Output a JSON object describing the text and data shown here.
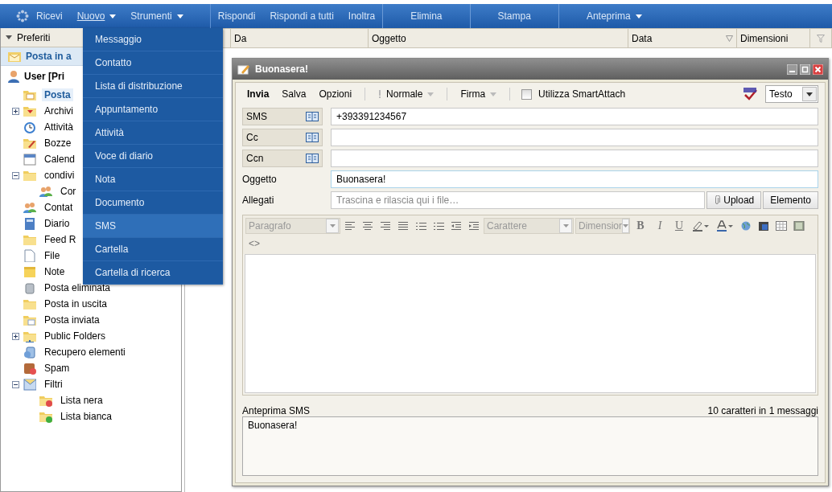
{
  "toolbar": {
    "items": [
      {
        "label": "Ricevi",
        "dropdown": false,
        "selected": false
      },
      {
        "label": "Nuovo",
        "dropdown": true,
        "selected": true
      },
      {
        "label": "Strumenti",
        "dropdown": true,
        "selected": false
      },
      {
        "label": "Rispondi",
        "dropdown": false,
        "selected": false
      },
      {
        "label": "Rispondi a tutti",
        "dropdown": false,
        "selected": false
      },
      {
        "label": "Inoltra",
        "dropdown": false,
        "selected": false
      },
      {
        "label": "Elimina",
        "dropdown": false,
        "selected": false
      },
      {
        "label": "Stampa",
        "dropdown": false,
        "selected": false
      },
      {
        "label": "Anteprima",
        "dropdown": true,
        "selected": false
      }
    ]
  },
  "menu": {
    "items": [
      {
        "label": "Messaggio",
        "selected": false
      },
      {
        "label": "Contatto",
        "selected": false
      },
      {
        "label": "Lista di distribuzione",
        "selected": false
      },
      {
        "label": "Appuntamento",
        "selected": false
      },
      {
        "label": "Attività",
        "selected": false
      },
      {
        "label": "Voce di diario",
        "selected": false
      },
      {
        "label": "Nota",
        "selected": false
      },
      {
        "label": "Documento",
        "selected": false
      },
      {
        "label": "SMS",
        "selected": true
      },
      {
        "label": "Cartella",
        "selected": false
      },
      {
        "label": "Cartella di ricerca",
        "selected": false
      }
    ]
  },
  "sidebar": {
    "header": "Preferiti",
    "favorite": "Posta in a",
    "account": "User [Pri",
    "items": [
      {
        "label": "Posta",
        "kind": "inbox",
        "selected": true
      },
      {
        "label": "Archivi",
        "kind": "archive",
        "selected": false,
        "expanded": false
      },
      {
        "label": "Attività",
        "kind": "tasks",
        "selected": false
      },
      {
        "label": "Bozze",
        "kind": "drafts",
        "selected": false
      },
      {
        "label": "Calend",
        "kind": "calendar",
        "selected": false
      },
      {
        "label": "condivi",
        "kind": "folder",
        "selected": false,
        "expanded": true,
        "children": [
          {
            "label": "Cor",
            "kind": "contacts",
            "selected": false
          }
        ]
      },
      {
        "label": "Contat",
        "kind": "contacts",
        "selected": false
      },
      {
        "label": "Diario",
        "kind": "journal",
        "selected": false
      },
      {
        "label": "Feed R",
        "kind": "folder",
        "selected": false
      },
      {
        "label": "File",
        "kind": "file",
        "selected": false
      },
      {
        "label": "Note",
        "kind": "notes",
        "selected": false
      },
      {
        "label": "Posta eliminata",
        "kind": "trash",
        "selected": false
      },
      {
        "label": "Posta in uscita",
        "kind": "folder",
        "selected": false
      },
      {
        "label": "Posta inviata",
        "kind": "sent",
        "selected": false
      },
      {
        "label": "Public Folders",
        "kind": "public",
        "selected": false,
        "expanded": false
      },
      {
        "label": "Recupero elementi",
        "kind": "recover",
        "selected": false
      },
      {
        "label": "Spam",
        "kind": "spam",
        "selected": false
      },
      {
        "label": "Filtri",
        "kind": "filter",
        "selected": false,
        "expanded": true,
        "children": [
          {
            "label": "Lista nera",
            "kind": "blacklist",
            "selected": false
          },
          {
            "label": "Lista bianca",
            "kind": "whitelist",
            "selected": false
          }
        ]
      }
    ]
  },
  "list": {
    "columns": [
      "Da",
      "Oggetto",
      "Data",
      "Dimensioni"
    ]
  },
  "compose": {
    "title": "Buonasera!",
    "toolbar": {
      "send": "Invia",
      "save": "Salva",
      "options": "Opzioni",
      "priority": "Normale",
      "signature": "Firma",
      "smartattach": {
        "label": "Utilizza SmartAttach",
        "checked": false
      },
      "format": "Testo"
    },
    "recipients": [
      {
        "label": "SMS",
        "value": "+393391234567"
      },
      {
        "label": "Cc"
      },
      {
        "label": "Ccn"
      }
    ],
    "subject": {
      "label": "Oggetto",
      "value": "Buonasera!"
    },
    "attachments": {
      "label": "Allegati",
      "placeholder": "Trascina e rilascia qui i file…",
      "upload": "Upload",
      "element": "Elemento"
    },
    "editor": {
      "paragraph": "Paragrafo",
      "font": "Carattere",
      "size": "Dimensior",
      "bold": "B",
      "italic": "I",
      "underline": "U",
      "source": "<>"
    },
    "preview": {
      "label": "Anteprima SMS",
      "counter": "10 caratteri in 1 messaggi",
      "text": "Buonasera!"
    }
  }
}
